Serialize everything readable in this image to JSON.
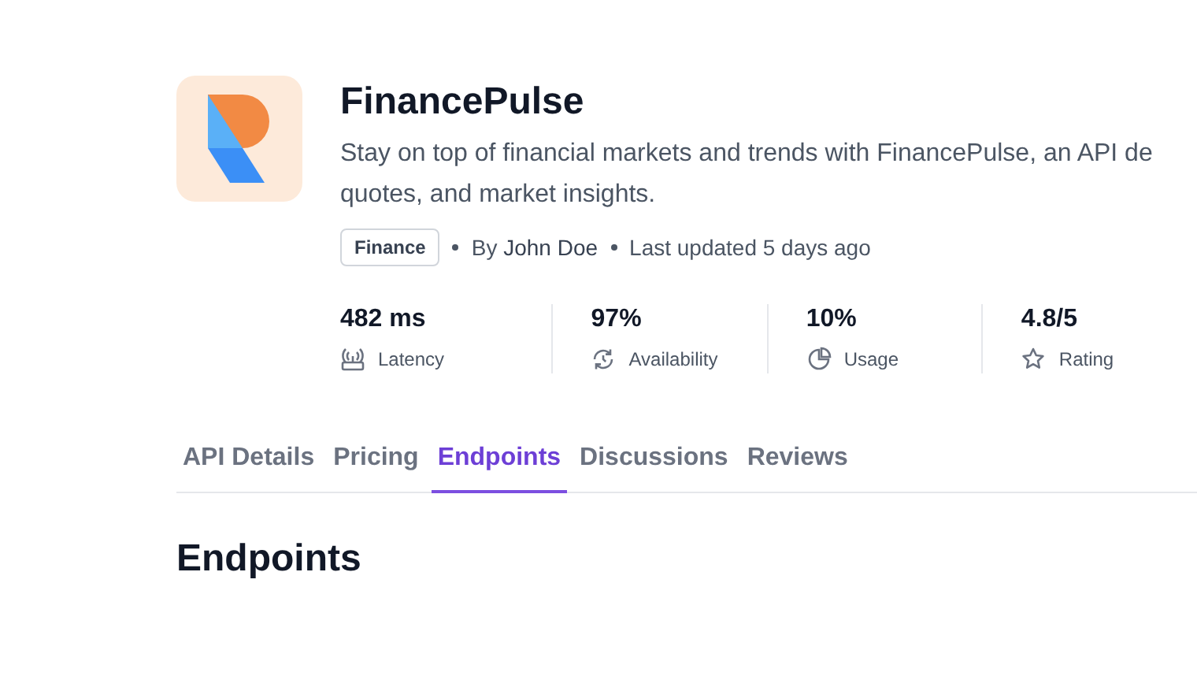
{
  "app": {
    "name": "FinancePulse",
    "description_lines": [
      "Stay on top of financial markets and trends with FinancePulse, an API de",
      "quotes, and market insights."
    ],
    "category": "Finance",
    "author_prefix": "By",
    "author": "John Doe",
    "updated": "Last updated 5 days ago"
  },
  "stats": [
    {
      "kind": "latency",
      "value": "482 ms",
      "label": "Latency"
    },
    {
      "kind": "availability",
      "value": "97%",
      "label": "Availability"
    },
    {
      "kind": "usage",
      "value": "10%",
      "label": "Usage"
    },
    {
      "kind": "rating",
      "value": "4.8/5",
      "label": "Rating"
    }
  ],
  "tabs": [
    {
      "label": "API Details",
      "selected": false
    },
    {
      "label": "Pricing",
      "selected": false
    },
    {
      "label": "Endpoints",
      "selected": true
    },
    {
      "label": "Discussions",
      "selected": false
    },
    {
      "label": "Reviews",
      "selected": false
    }
  ],
  "section_heading": "Endpoints"
}
